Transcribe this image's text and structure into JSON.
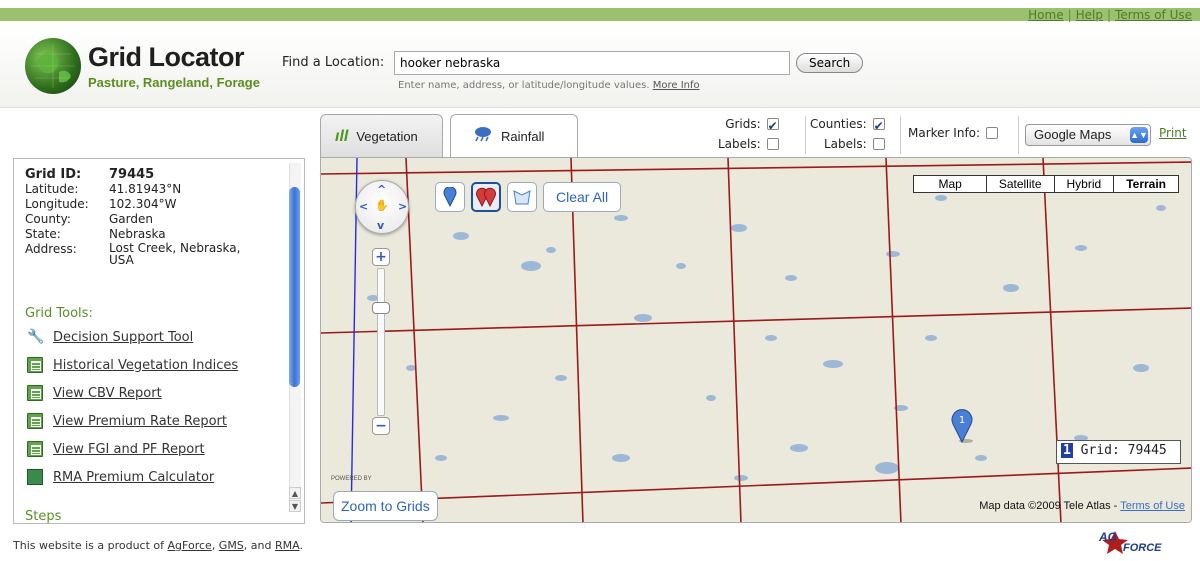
{
  "toplinks": {
    "home": "Home",
    "help": "Help",
    "terms": "Terms of Use",
    "sep": "|"
  },
  "brand": {
    "title": "Grid Locator",
    "subtitle": "Pasture, Rangeland, Forage"
  },
  "search": {
    "label": "Find a Location:",
    "value": "hooker nebraska",
    "button": "Search",
    "hint": "Enter name, address, or latitude/longitude values.",
    "hint_link": "More Info"
  },
  "tabs": [
    {
      "label": "Vegetation",
      "icon": "grass-icon",
      "active": true
    },
    {
      "label": "Rainfall",
      "icon": "rain-cloud-icon",
      "active": false
    }
  ],
  "options": {
    "grids_label": "Grids:",
    "grids_checked": true,
    "grid_labels_label": "Labels:",
    "grid_labels_checked": false,
    "counties_label": "Counties:",
    "counties_checked": true,
    "county_labels_label": "Labels:",
    "county_labels_checked": false,
    "marker_info_label": "Marker Info:",
    "marker_info_checked": false,
    "map_provider": "Google Maps",
    "print": "Print"
  },
  "grid_info": {
    "grid_id_label": "Grid ID:",
    "grid_id": "79445",
    "latitude_label": "Latitude:",
    "latitude": "41.81943°N",
    "longitude_label": "Longitude:",
    "longitude": "102.304°W",
    "county_label": "County:",
    "county": "Garden",
    "state_label": "State:",
    "state": "Nebraska",
    "address_label": "Address:",
    "address": "Lost Creek, Nebraska, USA"
  },
  "grid_tools": {
    "heading": "Grid Tools:",
    "items": [
      {
        "label": "Decision Support Tool",
        "icon": "wrench-icon"
      },
      {
        "label": "Historical Vegetation Indices",
        "icon": "spreadsheet-icon"
      },
      {
        "label": "View CBV Report",
        "icon": "spreadsheet-icon"
      },
      {
        "label": "View Premium Rate Report",
        "icon": "spreadsheet-icon"
      },
      {
        "label": "View FGI and PF Report",
        "icon": "spreadsheet-icon"
      },
      {
        "label": "RMA Premium Calculator",
        "icon": "calculator-icon"
      }
    ]
  },
  "steps_heading": "Steps",
  "map": {
    "types": [
      "Map",
      "Satellite",
      "Hybrid",
      "Terrain"
    ],
    "selected_type": "Terrain",
    "clear_all": "Clear All",
    "zoom_to_grids": "Zoom to Grids",
    "powered_by": "POWERED BY",
    "attribution": "Map data ©2009 Tele Atlas -",
    "attribution_link": "Terms of Use",
    "marker_number": "1",
    "grid_box_number": "1",
    "grid_box_text": "Grid: 79445",
    "grid_line_color": "#9b1b1b",
    "county_line_color": "#2a2adb"
  },
  "footer": {
    "prefix": "This website is a product of",
    "agforce": "AgForce",
    "comma": ",",
    "gms": "GMS",
    "and": ", and",
    "rma": "RMA",
    "period": ".",
    "logo_text": "AG FORCE"
  },
  "colors": {
    "brand_green": "#5b8f1e",
    "header_strip": "#9bc06e",
    "link_blue": "#2f64c0"
  }
}
